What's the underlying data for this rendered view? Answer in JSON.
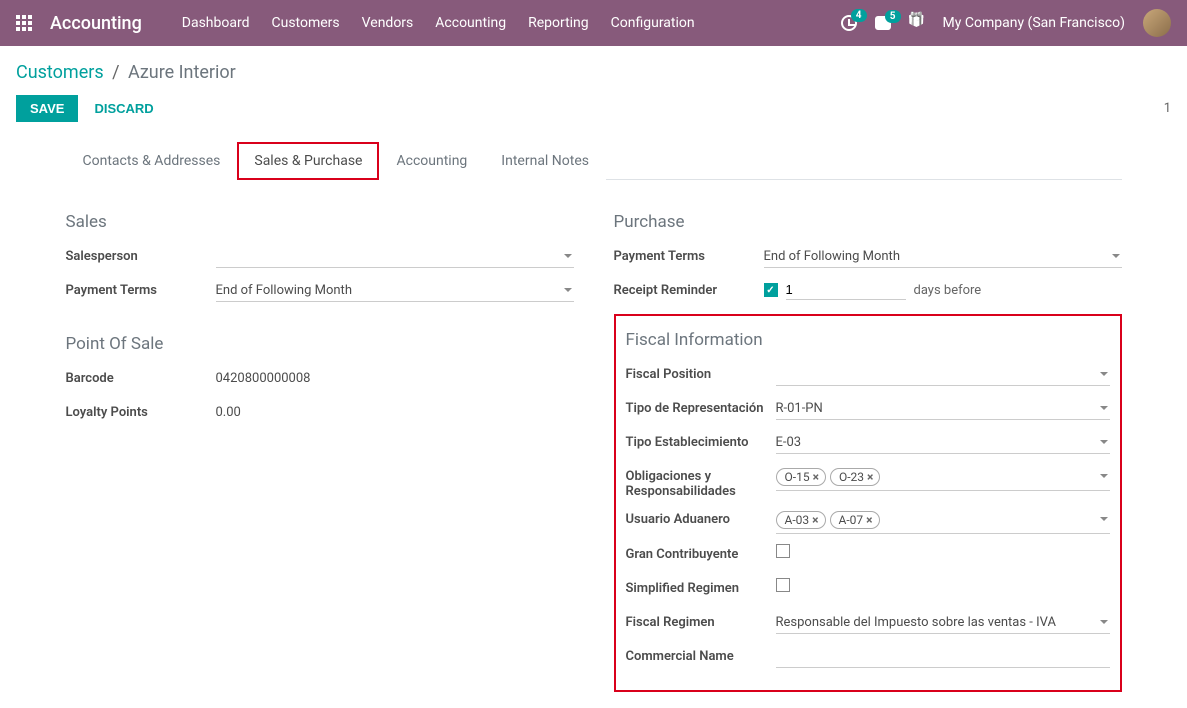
{
  "navbar": {
    "app_title": "Accounting",
    "menu": [
      "Dashboard",
      "Customers",
      "Vendors",
      "Accounting",
      "Reporting",
      "Configuration"
    ],
    "activities_count": "4",
    "messages_count": "5",
    "company": "My Company (San Francisco)"
  },
  "breadcrumb": {
    "parent": "Customers",
    "current": "Azure Interior"
  },
  "actions": {
    "save": "SAVE",
    "discard": "DISCARD",
    "page": "1"
  },
  "tabs": [
    "Contacts & Addresses",
    "Sales & Purchase",
    "Accounting",
    "Internal Notes"
  ],
  "sales": {
    "title": "Sales",
    "salesperson_label": "Salesperson",
    "salesperson_value": "",
    "payment_terms_label": "Payment Terms",
    "payment_terms_value": "End of Following Month"
  },
  "pos": {
    "title": "Point Of Sale",
    "barcode_label": "Barcode",
    "barcode_value": "0420800000008",
    "loyalty_label": "Loyalty Points",
    "loyalty_value": "0.00"
  },
  "purchase": {
    "title": "Purchase",
    "payment_terms_label": "Payment Terms",
    "payment_terms_value": "End of Following Month",
    "receipt_reminder_label": "Receipt Reminder",
    "receipt_reminder_value": "1",
    "receipt_reminder_suffix": "days before"
  },
  "fiscal": {
    "title": "Fiscal Information",
    "fiscal_position_label": "Fiscal Position",
    "fiscal_position_value": "",
    "tipo_rep_label": "Tipo de Representación",
    "tipo_rep_value": "R-01-PN",
    "tipo_est_label": "Tipo Establecimiento",
    "tipo_est_value": "E-03",
    "obligaciones_label": "Obligaciones y Responsabilidades",
    "obligaciones_tags": [
      "O-15",
      "O-23"
    ],
    "usuario_aduanero_label": "Usuario Aduanero",
    "usuario_aduanero_tags": [
      "A-03",
      "A-07"
    ],
    "gran_contribuyente_label": "Gran Contribuyente",
    "simplified_regimen_label": "Simplified Regimen",
    "fiscal_regimen_label": "Fiscal Regimen",
    "fiscal_regimen_value": "Responsable del Impuesto sobre las ventas - IVA",
    "commercial_name_label": "Commercial Name",
    "commercial_name_value": ""
  }
}
